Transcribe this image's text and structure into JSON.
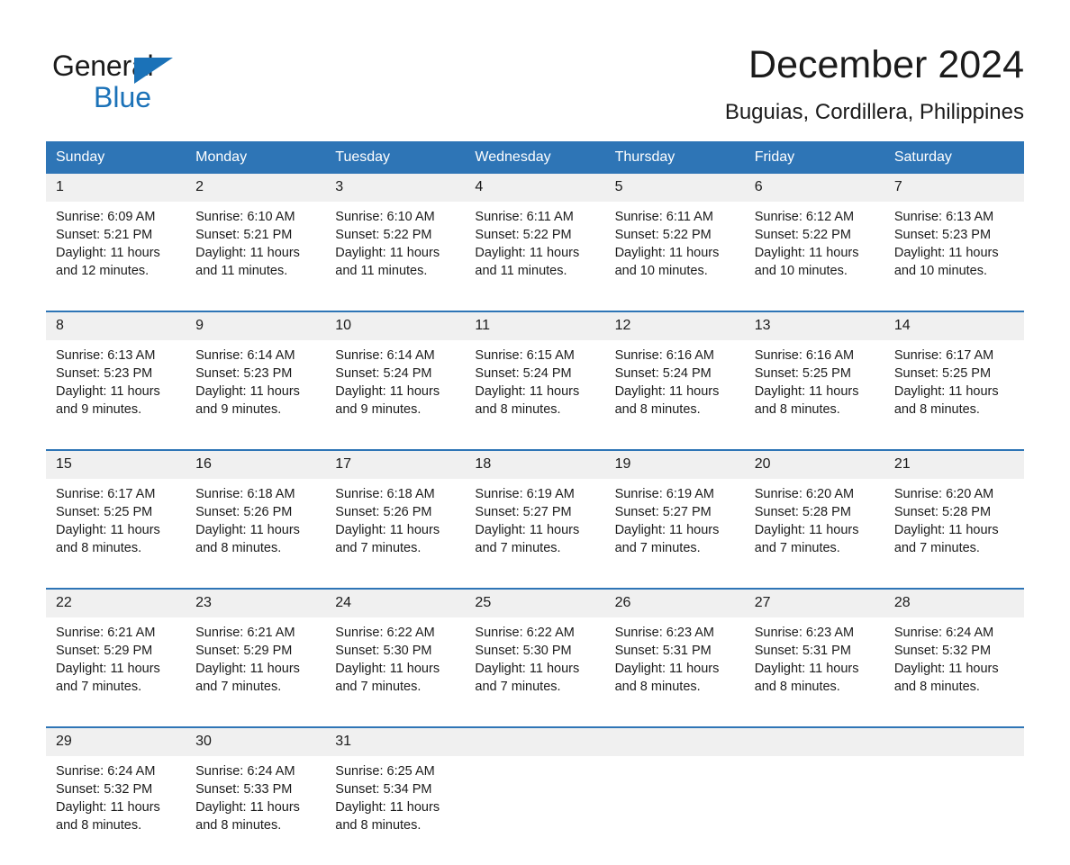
{
  "brand": {
    "line1": "General",
    "line2": "Blue",
    "triangle_color": "#1b72b8"
  },
  "header": {
    "title": "December 2024",
    "location": "Buguias, Cordillera, Philippines"
  },
  "theme": {
    "header_blue": "#2e75b6",
    "daynum_gray": "#f0f0f0",
    "text": "#1b1b1b"
  },
  "weekday_headers": [
    "Sunday",
    "Monday",
    "Tuesday",
    "Wednesday",
    "Thursday",
    "Friday",
    "Saturday"
  ],
  "weeks": [
    [
      {
        "day": "1",
        "sunrise": "Sunrise: 6:09 AM",
        "sunset": "Sunset: 5:21 PM",
        "daylight1": "Daylight: 11 hours",
        "daylight2": "and 12 minutes."
      },
      {
        "day": "2",
        "sunrise": "Sunrise: 6:10 AM",
        "sunset": "Sunset: 5:21 PM",
        "daylight1": "Daylight: 11 hours",
        "daylight2": "and 11 minutes."
      },
      {
        "day": "3",
        "sunrise": "Sunrise: 6:10 AM",
        "sunset": "Sunset: 5:22 PM",
        "daylight1": "Daylight: 11 hours",
        "daylight2": "and 11 minutes."
      },
      {
        "day": "4",
        "sunrise": "Sunrise: 6:11 AM",
        "sunset": "Sunset: 5:22 PM",
        "daylight1": "Daylight: 11 hours",
        "daylight2": "and 11 minutes."
      },
      {
        "day": "5",
        "sunrise": "Sunrise: 6:11 AM",
        "sunset": "Sunset: 5:22 PM",
        "daylight1": "Daylight: 11 hours",
        "daylight2": "and 10 minutes."
      },
      {
        "day": "6",
        "sunrise": "Sunrise: 6:12 AM",
        "sunset": "Sunset: 5:22 PM",
        "daylight1": "Daylight: 11 hours",
        "daylight2": "and 10 minutes."
      },
      {
        "day": "7",
        "sunrise": "Sunrise: 6:13 AM",
        "sunset": "Sunset: 5:23 PM",
        "daylight1": "Daylight: 11 hours",
        "daylight2": "and 10 minutes."
      }
    ],
    [
      {
        "day": "8",
        "sunrise": "Sunrise: 6:13 AM",
        "sunset": "Sunset: 5:23 PM",
        "daylight1": "Daylight: 11 hours",
        "daylight2": "and 9 minutes."
      },
      {
        "day": "9",
        "sunrise": "Sunrise: 6:14 AM",
        "sunset": "Sunset: 5:23 PM",
        "daylight1": "Daylight: 11 hours",
        "daylight2": "and 9 minutes."
      },
      {
        "day": "10",
        "sunrise": "Sunrise: 6:14 AM",
        "sunset": "Sunset: 5:24 PM",
        "daylight1": "Daylight: 11 hours",
        "daylight2": "and 9 minutes."
      },
      {
        "day": "11",
        "sunrise": "Sunrise: 6:15 AM",
        "sunset": "Sunset: 5:24 PM",
        "daylight1": "Daylight: 11 hours",
        "daylight2": "and 8 minutes."
      },
      {
        "day": "12",
        "sunrise": "Sunrise: 6:16 AM",
        "sunset": "Sunset: 5:24 PM",
        "daylight1": "Daylight: 11 hours",
        "daylight2": "and 8 minutes."
      },
      {
        "day": "13",
        "sunrise": "Sunrise: 6:16 AM",
        "sunset": "Sunset: 5:25 PM",
        "daylight1": "Daylight: 11 hours",
        "daylight2": "and 8 minutes."
      },
      {
        "day": "14",
        "sunrise": "Sunrise: 6:17 AM",
        "sunset": "Sunset: 5:25 PM",
        "daylight1": "Daylight: 11 hours",
        "daylight2": "and 8 minutes."
      }
    ],
    [
      {
        "day": "15",
        "sunrise": "Sunrise: 6:17 AM",
        "sunset": "Sunset: 5:25 PM",
        "daylight1": "Daylight: 11 hours",
        "daylight2": "and 8 minutes."
      },
      {
        "day": "16",
        "sunrise": "Sunrise: 6:18 AM",
        "sunset": "Sunset: 5:26 PM",
        "daylight1": "Daylight: 11 hours",
        "daylight2": "and 8 minutes."
      },
      {
        "day": "17",
        "sunrise": "Sunrise: 6:18 AM",
        "sunset": "Sunset: 5:26 PM",
        "daylight1": "Daylight: 11 hours",
        "daylight2": "and 7 minutes."
      },
      {
        "day": "18",
        "sunrise": "Sunrise: 6:19 AM",
        "sunset": "Sunset: 5:27 PM",
        "daylight1": "Daylight: 11 hours",
        "daylight2": "and 7 minutes."
      },
      {
        "day": "19",
        "sunrise": "Sunrise: 6:19 AM",
        "sunset": "Sunset: 5:27 PM",
        "daylight1": "Daylight: 11 hours",
        "daylight2": "and 7 minutes."
      },
      {
        "day": "20",
        "sunrise": "Sunrise: 6:20 AM",
        "sunset": "Sunset: 5:28 PM",
        "daylight1": "Daylight: 11 hours",
        "daylight2": "and 7 minutes."
      },
      {
        "day": "21",
        "sunrise": "Sunrise: 6:20 AM",
        "sunset": "Sunset: 5:28 PM",
        "daylight1": "Daylight: 11 hours",
        "daylight2": "and 7 minutes."
      }
    ],
    [
      {
        "day": "22",
        "sunrise": "Sunrise: 6:21 AM",
        "sunset": "Sunset: 5:29 PM",
        "daylight1": "Daylight: 11 hours",
        "daylight2": "and 7 minutes."
      },
      {
        "day": "23",
        "sunrise": "Sunrise: 6:21 AM",
        "sunset": "Sunset: 5:29 PM",
        "daylight1": "Daylight: 11 hours",
        "daylight2": "and 7 minutes."
      },
      {
        "day": "24",
        "sunrise": "Sunrise: 6:22 AM",
        "sunset": "Sunset: 5:30 PM",
        "daylight1": "Daylight: 11 hours",
        "daylight2": "and 7 minutes."
      },
      {
        "day": "25",
        "sunrise": "Sunrise: 6:22 AM",
        "sunset": "Sunset: 5:30 PM",
        "daylight1": "Daylight: 11 hours",
        "daylight2": "and 7 minutes."
      },
      {
        "day": "26",
        "sunrise": "Sunrise: 6:23 AM",
        "sunset": "Sunset: 5:31 PM",
        "daylight1": "Daylight: 11 hours",
        "daylight2": "and 8 minutes."
      },
      {
        "day": "27",
        "sunrise": "Sunrise: 6:23 AM",
        "sunset": "Sunset: 5:31 PM",
        "daylight1": "Daylight: 11 hours",
        "daylight2": "and 8 minutes."
      },
      {
        "day": "28",
        "sunrise": "Sunrise: 6:24 AM",
        "sunset": "Sunset: 5:32 PM",
        "daylight1": "Daylight: 11 hours",
        "daylight2": "and 8 minutes."
      }
    ],
    [
      {
        "day": "29",
        "sunrise": "Sunrise: 6:24 AM",
        "sunset": "Sunset: 5:32 PM",
        "daylight1": "Daylight: 11 hours",
        "daylight2": "and 8 minutes."
      },
      {
        "day": "30",
        "sunrise": "Sunrise: 6:24 AM",
        "sunset": "Sunset: 5:33 PM",
        "daylight1": "Daylight: 11 hours",
        "daylight2": "and 8 minutes."
      },
      {
        "day": "31",
        "sunrise": "Sunrise: 6:25 AM",
        "sunset": "Sunset: 5:34 PM",
        "daylight1": "Daylight: 11 hours",
        "daylight2": "and 8 minutes."
      },
      {
        "day": "",
        "sunrise": "",
        "sunset": "",
        "daylight1": "",
        "daylight2": ""
      },
      {
        "day": "",
        "sunrise": "",
        "sunset": "",
        "daylight1": "",
        "daylight2": ""
      },
      {
        "day": "",
        "sunrise": "",
        "sunset": "",
        "daylight1": "",
        "daylight2": ""
      },
      {
        "day": "",
        "sunrise": "",
        "sunset": "",
        "daylight1": "",
        "daylight2": ""
      }
    ]
  ]
}
